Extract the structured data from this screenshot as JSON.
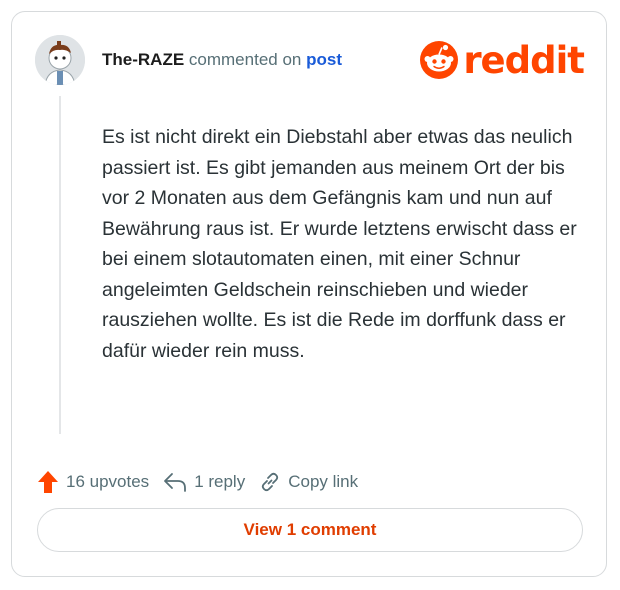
{
  "comment": {
    "author": "The-RAZE",
    "action_text": "commented on",
    "post_link": "post",
    "body": "Es ist nicht direkt ein Diebstahl aber etwas das neulich passiert ist. Es gibt jemanden aus meinem Ort der bis vor 2 Monaten aus dem Gefängnis kam und nun auf Bewährung raus ist. Er wurde letztens erwischt dass er bei einem slotautomaten einen, mit einer Schnur angeleimten Geldschein reinschieben und wieder rausziehen wollte. Es ist die Rede im dorffunk dass er dafür wieder rein muss."
  },
  "brand": {
    "logo_text": "reddit",
    "logo_icon": "snoo-icon",
    "accent_color": "#ff4500"
  },
  "actions": {
    "upvotes": "16 upvotes",
    "reply": "1 reply",
    "copy_link": "Copy link"
  },
  "footer": {
    "view_comments": "View 1 comment"
  },
  "icons": {
    "upvote": "upvote-arrow-icon",
    "reply": "reply-arrow-icon",
    "copy": "link-chain-icon",
    "avatar": "user-avatar"
  }
}
